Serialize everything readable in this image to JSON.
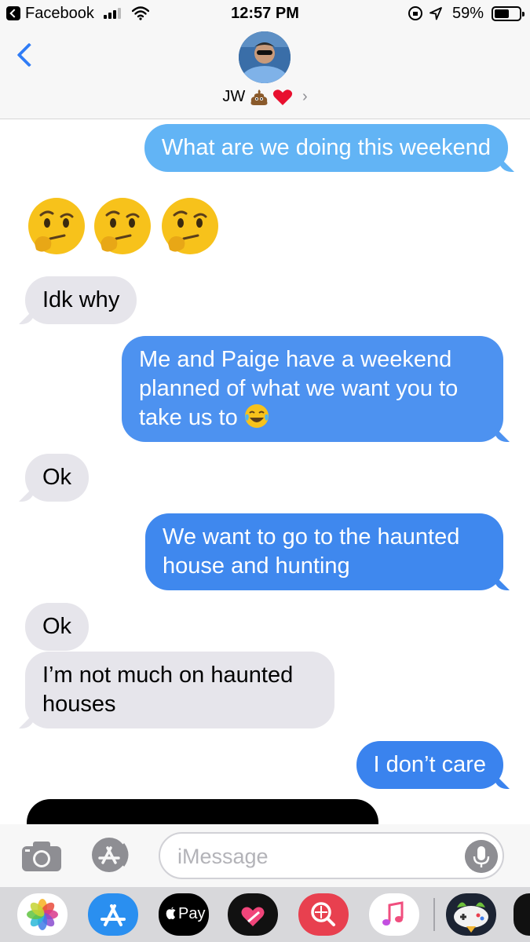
{
  "status_bar": {
    "back_app": "Facebook",
    "time": "12:57 PM",
    "battery_percent": "59%",
    "battery_level": 0.59
  },
  "header": {
    "contact_name": "JW",
    "contact_emojis": [
      "pile-of-poo",
      "red-heart"
    ],
    "chevron": "›"
  },
  "messages": [
    {
      "direction": "sent",
      "text": "What are we doing this weekend"
    },
    {
      "direction": "received",
      "type": "emoji",
      "emoji": "thinking-face",
      "count": 3
    },
    {
      "direction": "received",
      "text": "Idk why"
    },
    {
      "direction": "sent",
      "text": "Me and Paige have a weekend planned of what we want you to take us to",
      "emoji": "face-with-tears-of-joy"
    },
    {
      "direction": "received",
      "text": "Ok"
    },
    {
      "direction": "sent",
      "text": "We want to go to the haunted house and hunting"
    },
    {
      "direction": "received",
      "text": "Ok"
    },
    {
      "direction": "received",
      "text": "I’m not much on haunted houses"
    },
    {
      "direction": "sent",
      "text": "I don’t care"
    }
  ],
  "input_bar": {
    "placeholder": "iMessage"
  },
  "app_drawer": {
    "apps": [
      "photos",
      "app-store",
      "apple-pay",
      "heart-digital-touch",
      "web-images",
      "music",
      "game"
    ],
    "apple_pay_label": "Pay"
  },
  "colors": {
    "sent_bubble": "#4a90ef",
    "received_bubble": "#e6e5eb",
    "accent": "#2f7cf6"
  }
}
